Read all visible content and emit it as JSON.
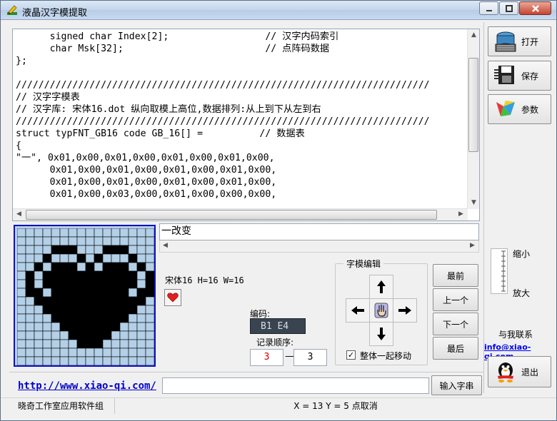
{
  "window": {
    "title": "液晶汉字模提取"
  },
  "code": {
    "lines": [
      "      signed char Index[2];                 // 汉字内码索引",
      "      char Msk[32];                         // 点阵码数据",
      "};",
      "",
      "/////////////////////////////////////////////////////////////////////////",
      "// 汉字字模表",
      "// 汉字库: 宋体16.dot 纵向取模上高位,数据排列:从上到下从左到右",
      "/////////////////////////////////////////////////////////////////////////",
      "struct typFNT_GB16 code GB_16[] =          // 数据表",
      "{",
      "\"一\", 0x01,0x00,0x01,0x00,0x01,0x00,0x01,0x00,",
      "      0x01,0x00,0x01,0x00,0x01,0x00,0x01,0x00,",
      "      0x01,0x00,0x01,0x00,0x01,0x00,0x01,0x00,",
      "      0x01,0x00,0x03,0x00,0x01,0x00,0x00,0x00,"
    ]
  },
  "text_line": "一改变",
  "font_info": "宋体16 H=16 W=16",
  "encoding": {
    "label": "编码:",
    "value": "B1 E4"
  },
  "record_order": {
    "label": "记录顺序:",
    "current": "3",
    "total": "3",
    "separator": "—"
  },
  "glyph_editor": {
    "title": "字模编辑",
    "move_all_label": "整体一起移动",
    "move_all_checked": true,
    "check_mark": "✓"
  },
  "nav_buttons": {
    "first": "最前",
    "prev": "上一个",
    "next": "下一个",
    "last": "最后"
  },
  "right_buttons": {
    "open": "打开",
    "save": "保存",
    "params": "参数",
    "exit": "退出"
  },
  "zoom": {
    "shrink": "缩小",
    "enlarge": "放大"
  },
  "contact": {
    "label": "与我联系",
    "email": "info@xiao-qi.com"
  },
  "bottom": {
    "url": "http://www.xiao-qi.com/",
    "input_button": "输入字串"
  },
  "status": {
    "left": "晓奇工作室应用软件组",
    "coords": "X = 13 Y = 5 点取消"
  },
  "bitmap": {
    "grid_cols": 16,
    "grid_rows": 16,
    "rows": [
      "0000000000000000",
      "0000000000000000",
      "0000111000111000",
      "0001000101000100",
      "0010111010111010",
      "0101111111111101",
      "0101111111111101",
      "0110111111111011",
      "0011111111111110",
      "0001111111111100",
      "0000111111111000",
      "0000011111110000",
      "0000001111100000",
      "0000000111000000",
      "0000000000000000",
      "0000000000000000"
    ],
    "on_color": "#000000",
    "off_color": "#b3d0e8",
    "grid_color": "#000000"
  },
  "colors": {
    "link": "#0000cc",
    "frame": "#1010c8",
    "order_current": "#d00000"
  }
}
